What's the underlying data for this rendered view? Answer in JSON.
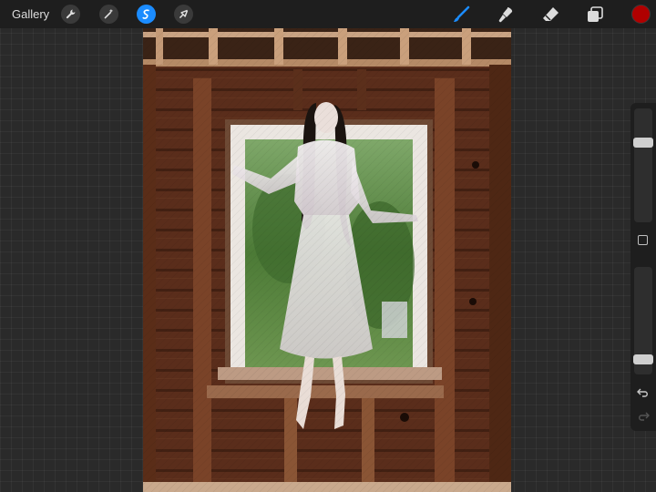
{
  "toolbar": {
    "gallery_label": "Gallery",
    "left_tools": [
      "wrench-icon",
      "magic-wand-icon",
      "selection-icon",
      "transform-arrow-icon"
    ],
    "right_tools": [
      "brush-icon",
      "smudge-icon",
      "eraser-icon",
      "layers-icon"
    ],
    "active_color": "#b00000",
    "accent": "#1b8cff"
  },
  "sidebar": {
    "brush_size": 0.72,
    "opacity": 0.1,
    "icons": [
      "modify-button",
      "undo-icon",
      "redo-icon"
    ]
  }
}
